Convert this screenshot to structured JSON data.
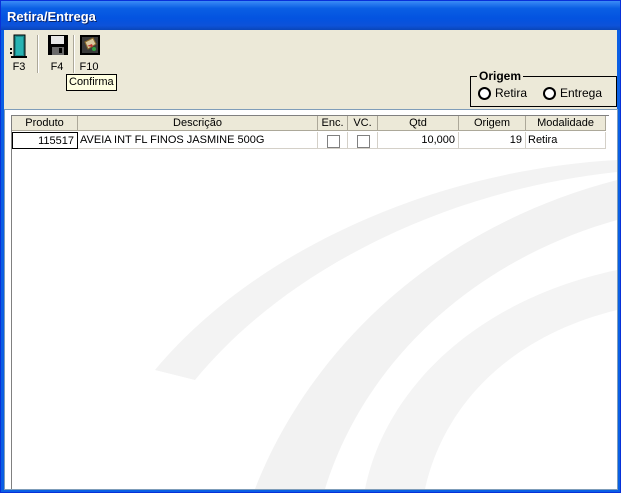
{
  "window": {
    "title": "Retira/Entrega"
  },
  "toolbar": {
    "buttons": [
      {
        "key": "F3",
        "icon": "door-exit-icon"
      },
      {
        "key": "F4",
        "icon": "floppy-save-icon"
      },
      {
        "key": "F10",
        "icon": "confirm-icon"
      }
    ],
    "tooltip": "Confirma"
  },
  "origem": {
    "title": "Origem",
    "options": [
      {
        "label": "Retira",
        "selected": false
      },
      {
        "label": "Entrega",
        "selected": false
      }
    ]
  },
  "table": {
    "columns": [
      "Produto",
      "Descrição",
      "Enc.",
      "VC.",
      "Qtd",
      "Origem",
      "Modalidade"
    ],
    "rows": [
      {
        "produto": "115517",
        "descricao": "AVEIA INT FL FINOS JASMINE 500G",
        "enc": false,
        "vc": false,
        "qtd": "10,000",
        "origem": "19",
        "modalidade": "Retira"
      }
    ]
  }
}
